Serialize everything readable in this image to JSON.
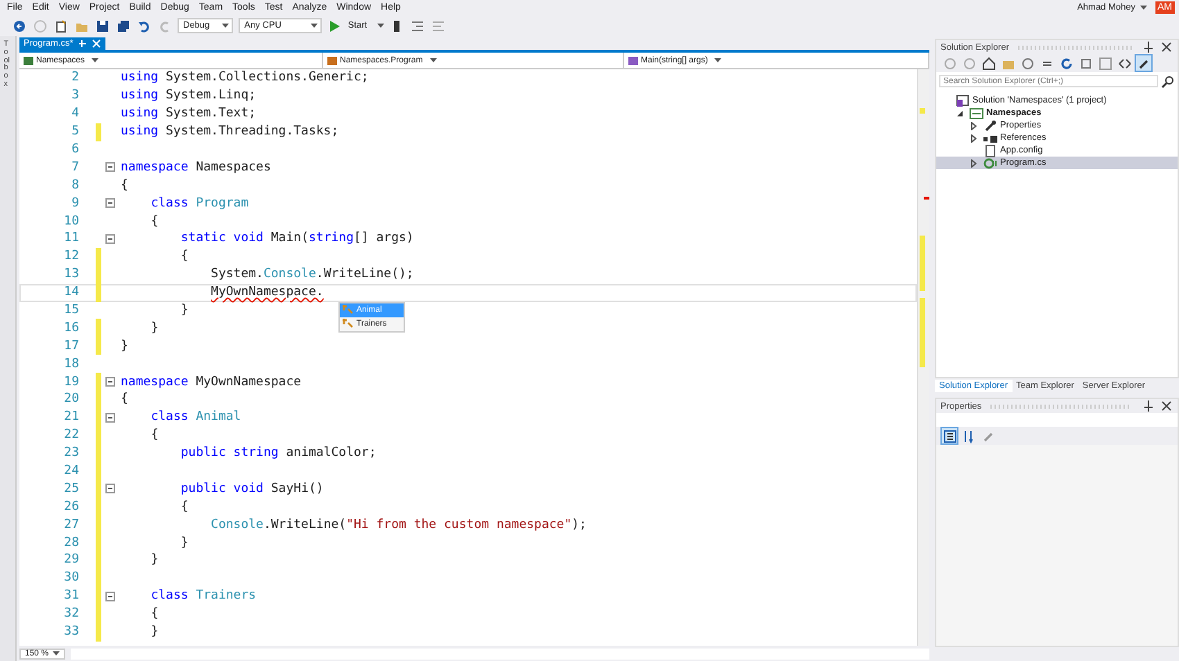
{
  "menu": [
    "File",
    "Edit",
    "View",
    "Project",
    "Build",
    "Debug",
    "Team",
    "Tools",
    "Test",
    "Analyze",
    "Window",
    "Help"
  ],
  "toolbar": {
    "configuration": "Debug",
    "platform": "Any CPU",
    "start": "Start"
  },
  "account": {
    "name": "Ahmad Mohey",
    "initials": "AM"
  },
  "toolbox_label": "Toolbox",
  "document_tabs": [
    {
      "label": "Program.cs*",
      "selected": true
    }
  ],
  "navigation": {
    "project": "Namespaces",
    "type": "Namespaces.Program",
    "member": "Main(string[] args)"
  },
  "code_lines": [
    {
      "number": "2",
      "changed": false,
      "collapsible": false,
      "current": false,
      "segments": [
        {
          "kind": "keyword",
          "text": "using"
        },
        {
          "kind": "plain",
          "text": " System.Collections.Generic;"
        }
      ]
    },
    {
      "number": "3",
      "changed": false,
      "collapsible": false,
      "current": false,
      "segments": [
        {
          "kind": "keyword",
          "text": "using"
        },
        {
          "kind": "plain",
          "text": " System.Linq;"
        }
      ]
    },
    {
      "number": "4",
      "changed": false,
      "collapsible": false,
      "current": false,
      "segments": [
        {
          "kind": "keyword",
          "text": "using"
        },
        {
          "kind": "plain",
          "text": " System.Text;"
        }
      ]
    },
    {
      "number": "5",
      "changed": true,
      "collapsible": false,
      "current": false,
      "segments": [
        {
          "kind": "keyword",
          "text": "using"
        },
        {
          "kind": "plain",
          "text": " System.Threading.Tasks;"
        }
      ]
    },
    {
      "number": "6",
      "changed": false,
      "collapsible": false,
      "current": false
    },
    {
      "number": "7",
      "changed": false,
      "collapsible": true,
      "current": false,
      "segments": [
        {
          "kind": "keyword",
          "text": "namespace"
        },
        {
          "kind": "plain",
          "text": " Namespaces"
        }
      ]
    },
    {
      "number": "8",
      "changed": false,
      "collapsible": false,
      "current": false,
      "segments": [
        {
          "kind": "plain",
          "text": "{"
        }
      ]
    },
    {
      "number": "9",
      "changed": false,
      "collapsible": true,
      "current": false,
      "segments": [
        {
          "kind": "keyword",
          "text": "    class "
        },
        {
          "kind": "type",
          "text": "Program"
        }
      ]
    },
    {
      "number": "10",
      "changed": false,
      "collapsible": false,
      "current": false,
      "segments": [
        {
          "kind": "plain",
          "text": "    {"
        }
      ]
    },
    {
      "number": "11",
      "changed": false,
      "collapsible": true,
      "current": false,
      "segments": [
        {
          "kind": "keyword",
          "text": "        static void"
        },
        {
          "kind": "plain",
          "text": " Main("
        },
        {
          "kind": "keyword",
          "text": "string"
        },
        {
          "kind": "plain",
          "text": "[] args)"
        }
      ]
    },
    {
      "number": "12",
      "changed": true,
      "collapsible": false,
      "current": false,
      "segments": [
        {
          "kind": "plain",
          "text": "        {"
        }
      ]
    },
    {
      "number": "13",
      "changed": true,
      "collapsible": false,
      "current": false,
      "segments": [
        {
          "kind": "plain",
          "text": "            System."
        },
        {
          "kind": "type",
          "text": "Console"
        },
        {
          "kind": "plain",
          "text": ".WriteLine();"
        }
      ]
    },
    {
      "number": "14",
      "changed": true,
      "collapsible": false,
      "current": true,
      "segments": [
        {
          "kind": "error",
          "text": "            MyOwnNamespace."
        }
      ]
    },
    {
      "number": "15",
      "changed": false,
      "collapsible": false,
      "current": false,
      "segments": [
        {
          "kind": "plain",
          "text": "        }"
        }
      ]
    },
    {
      "number": "16",
      "changed": true,
      "collapsible": false,
      "current": false,
      "segments": [
        {
          "kind": "plain",
          "text": "    }"
        }
      ]
    },
    {
      "number": "17",
      "changed": true,
      "collapsible": false,
      "current": false,
      "segments": [
        {
          "kind": "plain",
          "text": "}"
        }
      ]
    },
    {
      "number": "18",
      "changed": false,
      "collapsible": false,
      "current": false
    },
    {
      "number": "19",
      "changed": true,
      "collapsible": true,
      "current": false,
      "segments": [
        {
          "kind": "keyword",
          "text": "namespace"
        },
        {
          "kind": "plain",
          "text": " MyOwnNamespace"
        }
      ]
    },
    {
      "number": "20",
      "changed": true,
      "collapsible": false,
      "current": false,
      "segments": [
        {
          "kind": "plain",
          "text": "{"
        }
      ]
    },
    {
      "number": "21",
      "changed": true,
      "collapsible": true,
      "current": false,
      "segments": [
        {
          "kind": "keyword",
          "text": "    class "
        },
        {
          "kind": "type",
          "text": "Animal"
        }
      ]
    },
    {
      "number": "22",
      "changed": true,
      "collapsible": false,
      "current": false,
      "segments": [
        {
          "kind": "plain",
          "text": "    {"
        }
      ]
    },
    {
      "number": "23",
      "changed": true,
      "collapsible": false,
      "current": false,
      "segments": [
        {
          "kind": "keyword",
          "text": "        public string"
        },
        {
          "kind": "plain",
          "text": " animalColor;"
        }
      ]
    },
    {
      "number": "24",
      "changed": true,
      "collapsible": false,
      "current": false
    },
    {
      "number": "25",
      "changed": true,
      "collapsible": true,
      "current": false,
      "segments": [
        {
          "kind": "keyword",
          "text": "        public void"
        },
        {
          "kind": "plain",
          "text": " SayHi()"
        }
      ]
    },
    {
      "number": "26",
      "changed": true,
      "collapsible": false,
      "current": false,
      "segments": [
        {
          "kind": "plain",
          "text": "        {"
        }
      ]
    },
    {
      "number": "27",
      "changed": true,
      "collapsible": false,
      "current": false,
      "segments": [
        {
          "kind": "type",
          "text": "            Console"
        },
        {
          "kind": "plain",
          "text": ".WriteLine("
        },
        {
          "kind": "string",
          "text": "\"Hi from the custom namespace\""
        },
        {
          "kind": "plain",
          "text": ");"
        }
      ]
    },
    {
      "number": "28",
      "changed": true,
      "collapsible": false,
      "current": false,
      "segments": [
        {
          "kind": "plain",
          "text": "        }"
        }
      ]
    },
    {
      "number": "29",
      "changed": true,
      "collapsible": false,
      "current": false,
      "segments": [
        {
          "kind": "plain",
          "text": "    }"
        }
      ]
    },
    {
      "number": "30",
      "changed": true,
      "collapsible": false,
      "current": false
    },
    {
      "number": "31",
      "changed": true,
      "collapsible": true,
      "current": false,
      "segments": [
        {
          "kind": "keyword",
          "text": "    class "
        },
        {
          "kind": "type",
          "text": "Trainers"
        }
      ]
    },
    {
      "number": "32",
      "changed": true,
      "collapsible": false,
      "current": false,
      "segments": [
        {
          "kind": "plain",
          "text": "    {"
        }
      ]
    },
    {
      "number": "33",
      "changed": true,
      "collapsible": false,
      "current": false,
      "segments": [
        {
          "kind": "plain",
          "text": "    }"
        }
      ]
    }
  ],
  "completion": {
    "items": [
      {
        "label": "Animal",
        "selected": true
      },
      {
        "label": "Trainers",
        "selected": false
      }
    ]
  },
  "zoom": "150 %",
  "solution_explorer": {
    "title": "Solution Explorer",
    "search": {
      "placeholder": "Search Solution Explorer (Ctrl+;)"
    },
    "tree": [
      {
        "label": "Solution 'Namespaces' (1 project)",
        "kind": "solution",
        "selected": false,
        "children": [
          {
            "label": "Namespaces",
            "kind": "project",
            "selected": false,
            "expanded": true,
            "children": [
              {
                "label": "Properties",
                "kind": "properties",
                "selected": false,
                "expanded": false
              },
              {
                "label": "References",
                "kind": "references",
                "selected": false,
                "expanded": false
              },
              {
                "label": "App.config",
                "kind": "config",
                "selected": false
              },
              {
                "label": "Program.cs",
                "kind": "csharp",
                "selected": true,
                "expanded": false
              }
            ]
          }
        ]
      }
    ]
  },
  "panel_tabs": [
    {
      "label": "Solution Explorer",
      "selected": true
    },
    {
      "label": "Team Explorer",
      "selected": false
    },
    {
      "label": "Server Explorer",
      "selected": false
    }
  ],
  "properties": {
    "title": "Properties"
  }
}
